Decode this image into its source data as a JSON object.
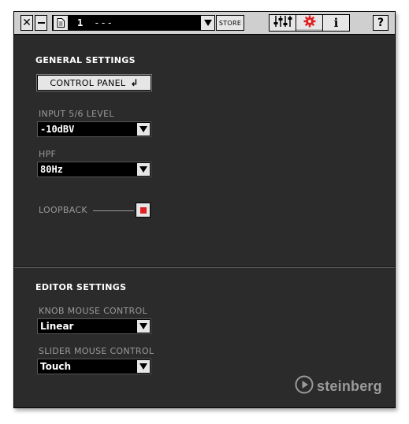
{
  "toolbar": {
    "close_symbol": "✕",
    "preset_number": "1",
    "preset_name": "---",
    "store_label": "STORE",
    "tabs": [
      {
        "icon": "mixer-sliders-icon"
      },
      {
        "icon": "gear-icon",
        "active": true
      },
      {
        "icon": "info-icon",
        "label": "i"
      }
    ],
    "help_label": "?"
  },
  "general": {
    "title": "GENERAL SETTINGS",
    "control_panel_label": "CONTROL PANEL",
    "control_panel_symbol": "↲",
    "input_level_label": "INPUT 5/6 LEVEL",
    "input_level_value": "-10dBV",
    "hpf_label": "HPF",
    "hpf_value": "80Hz",
    "loopback_label": "LOOPBACK",
    "loopback_on": true
  },
  "editor": {
    "title": "EDITOR SETTINGS",
    "knob_label": "KNOB MOUSE CONTROL",
    "knob_value": "Linear",
    "slider_label": "SLIDER MOUSE CONTROL",
    "slider_value": "Touch"
  },
  "brand": {
    "name": "steinberg"
  },
  "colors": {
    "panel_bg": "#2b2b2b",
    "toolbar_bg": "#cfcfcf",
    "accent_red": "#e02020",
    "label_gray": "#9a9a9a"
  }
}
